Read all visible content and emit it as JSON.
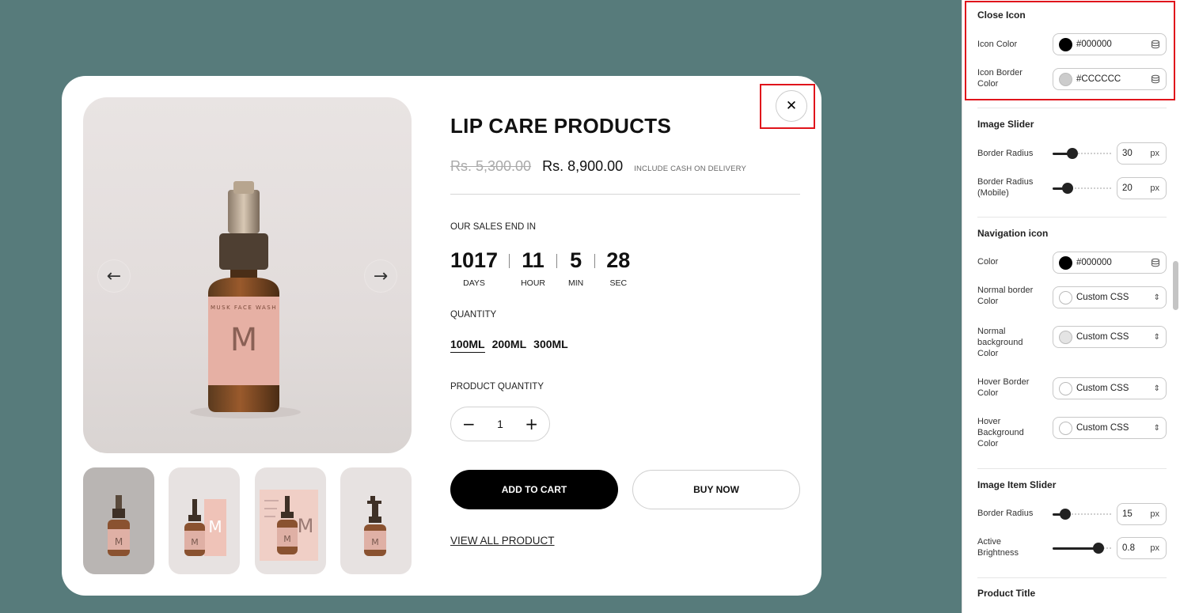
{
  "product": {
    "title": "LIP CARE PRODUCTS",
    "old_price": "Rs. 5,300.00",
    "new_price": "Rs. 8,900.00",
    "price_note": "INCLUDE CASH ON DELIVERY",
    "sales_end_label": "OUR SALES END IN",
    "countdown": [
      {
        "value": "1017",
        "label": "DAYS"
      },
      {
        "value": "11",
        "label": "HOUR"
      },
      {
        "value": "5",
        "label": "MIN"
      },
      {
        "value": "28",
        "label": "SEC"
      }
    ],
    "quantity_label": "QUANTITY",
    "sizes": [
      "100ML",
      "200ML",
      "300ML"
    ],
    "selected_size": "100ML",
    "product_quantity_label": "PRODUCT QUANTITY",
    "qty_minus": "−",
    "qty_plus": "+",
    "qty_value": "1",
    "add_to_cart": "ADD TO CART",
    "buy_now": "BUY NOW",
    "view_all": "VIEW ALL PRODUCT",
    "bottle_letter": "M",
    "bottle_brand": "MUSK FACE WASH",
    "prev_arrow": "←",
    "next_arrow": "→",
    "close_glyph": "✕",
    "thumbnail_count": 4,
    "active_thumbnail": 1
  },
  "panel": {
    "close_icon": {
      "title": "Close Icon",
      "icon_color_label": "Icon Color",
      "icon_color": "#000000",
      "icon_border_label": "Icon Border Color",
      "icon_border_color": "#CCCCCC"
    },
    "image_slider": {
      "title": "Image Slider",
      "border_radius_label": "Border Radius",
      "border_radius": "30",
      "border_radius_mobile_label": "Border Radius (Mobile)",
      "border_radius_mobile": "20",
      "unit": "px"
    },
    "navigation_icon": {
      "title": "Navigation icon",
      "color_label": "Color",
      "color": "#000000",
      "normal_border_label": "Normal border Color",
      "normal_background_label": "Normal background Color",
      "hover_border_label": "Hover Border Color",
      "hover_background_label": "Hover Background Color",
      "custom_css": "Custom CSS"
    },
    "image_item_slider": {
      "title": "Image Item Slider",
      "border_radius_label": "Border Radius",
      "border_radius": "15",
      "active_brightness_label": "Active Brightness",
      "active_brightness": "0.8",
      "unit": "px"
    },
    "product_title": {
      "title": "Product Title"
    }
  },
  "colors": {
    "canvas_bg": "#577b7b",
    "highlight": "#e0141b",
    "button_black": "#000000"
  },
  "icons": {
    "database": "database-icon",
    "chevron": "chevron-updown-icon",
    "close": "close-icon",
    "arrow_left": "arrow-left-icon",
    "arrow_right": "arrow-right-icon"
  }
}
